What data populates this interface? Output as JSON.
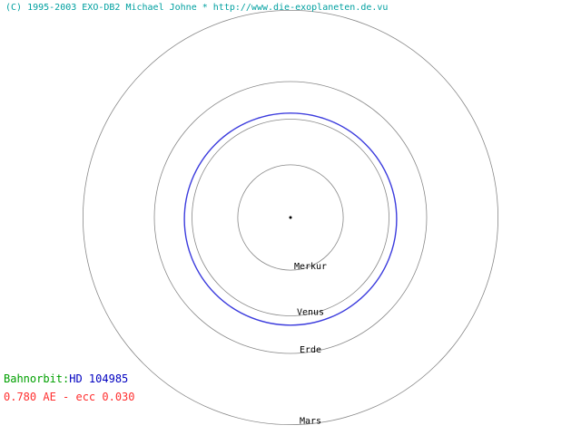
{
  "header": {
    "copyright": "(C) 1995-2003 EXO-DB2 Michael Johne * http://www.die-exoplaneten.de.vu"
  },
  "legend": {
    "prefix": "Bahnorbit:",
    "object": "HD 104985",
    "params": "0.780 AE - ecc 0.030"
  },
  "chart_data": {
    "type": "orbit-diagram",
    "unit": "AE",
    "planets": [
      {
        "name": "Merkur",
        "a": 0.387
      },
      {
        "name": "Venus",
        "a": 0.723
      },
      {
        "name": "Erde",
        "a": 1.0
      },
      {
        "name": "Mars",
        "a": 1.524
      }
    ],
    "exoplanet": {
      "name": "HD 104985",
      "a": 0.78,
      "ecc": 0.03
    }
  },
  "colors": {
    "copyright": "#00a0a0",
    "legend_prefix": "#00a000",
    "legend_object": "#0000c0",
    "legend_params": "#ff3030",
    "orbit_ring": "#888888",
    "exo_orbit": "#3b3bdd",
    "star": "#000000",
    "planet_label": "#000000"
  }
}
